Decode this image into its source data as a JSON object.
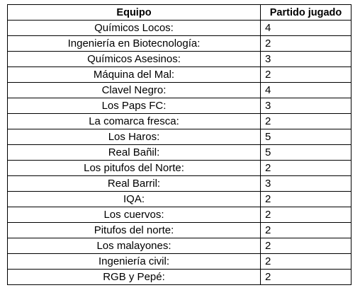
{
  "table": {
    "headers": {
      "team": "Equipo",
      "played": "Partido jugado"
    },
    "rows": [
      {
        "team": "Químicos Locos:",
        "played": "4"
      },
      {
        "team": "Ingeniería en Biotecnología:",
        "played": "2"
      },
      {
        "team": "Químicos Asesinos:",
        "played": "3"
      },
      {
        "team": "Máquina del Mal:",
        "played": "2"
      },
      {
        "team": "Clavel Negro:",
        "played": "4"
      },
      {
        "team": "Los Paps FC:",
        "played": "3"
      },
      {
        "team": "La comarca fresca:",
        "played": "2"
      },
      {
        "team": "Los Haros:",
        "played": "5"
      },
      {
        "team": "Real Bañil:",
        "played": "5"
      },
      {
        "team": "Los pitufos del Norte:",
        "played": "2"
      },
      {
        "team": "Real Barril:",
        "played": "3"
      },
      {
        "team": "IQA:",
        "played": "2"
      },
      {
        "team": "Los cuervos:",
        "played": "2"
      },
      {
        "team": "Pitufos del norte:",
        "played": "2"
      },
      {
        "team": "Los malayones:",
        "played": "2"
      },
      {
        "team": "Ingeniería civil:",
        "played": "2"
      },
      {
        "team": "RGB  y Pepé:",
        "played": "2"
      }
    ]
  }
}
